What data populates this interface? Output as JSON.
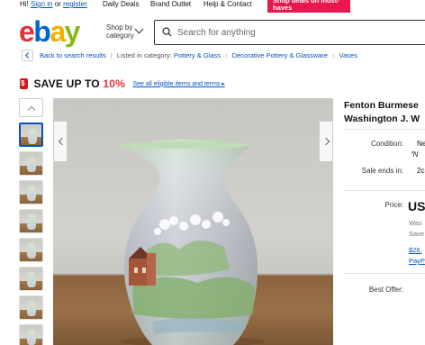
{
  "topbar": {
    "greeting_prefix": "Hi!",
    "sign_in": "Sign in",
    "or": "or",
    "register": "register",
    "links": [
      "Daily Deals",
      "Brand Outlet",
      "Help & Contact"
    ],
    "promo": "Shop deals on must-haves"
  },
  "header": {
    "logo_letters": [
      "e",
      "b",
      "a",
      "y"
    ],
    "shop_by_line1": "Shop by",
    "shop_by_line2": "category",
    "search_placeholder": "Search for anything"
  },
  "breadcrumb": {
    "back": "Back to search results",
    "listed_in": "Listed in category:",
    "path": [
      "Pottery & Glass",
      "Decorative Pottery & Glassware",
      "Vases"
    ]
  },
  "save_banner": {
    "text": "SAVE UP TO",
    "percent": "10%",
    "link": "See all eligible items and terms ▸"
  },
  "thumbnails": {
    "count": 8,
    "selected_index": 0
  },
  "listing": {
    "title_line1": "Fenton Burmese",
    "title_line2": "Washington J. W",
    "condition_label": "Condition:",
    "condition_value": "Ne",
    "condition_note": "“N",
    "sale_ends_label": "Sale ends in:",
    "sale_ends_value": "2c",
    "price_label": "Price:",
    "price_value": "US",
    "was_label": "Was",
    "save_label": "Save",
    "installment": "$26.",
    "paypal": "PayP",
    "best_offer_label": "Best Offer:"
  },
  "colors": {
    "link": "#0654ba",
    "promo": "#e8174d",
    "save_red": "#e53238"
  }
}
